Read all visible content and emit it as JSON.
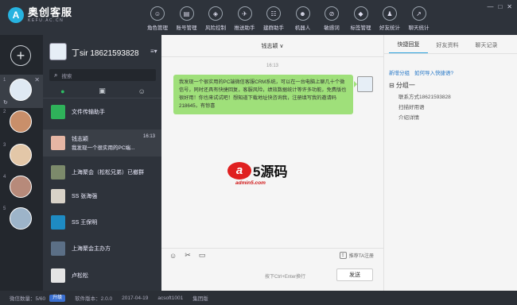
{
  "app": {
    "title": "奥创客服",
    "subtitle": "KEFU.AC.CN",
    "logo_letter": "A"
  },
  "nav": [
    {
      "label": "角色管理",
      "icon": "user-icon",
      "glyph": "☺"
    },
    {
      "label": "账号管理",
      "icon": "account-icon",
      "glyph": "▤"
    },
    {
      "label": "风险控制",
      "icon": "shield-icon",
      "glyph": "◈"
    },
    {
      "label": "推送助手",
      "icon": "push-icon",
      "glyph": "✈"
    },
    {
      "label": "建群助手",
      "icon": "group-icon",
      "glyph": "☷"
    },
    {
      "label": "机器人",
      "icon": "robot-icon",
      "glyph": "☻"
    },
    {
      "label": "敏感词",
      "icon": "block-icon",
      "glyph": "⊘"
    },
    {
      "label": "标签管理",
      "icon": "tag-icon",
      "glyph": "◆"
    },
    {
      "label": "好友统计",
      "icon": "stats-icon",
      "glyph": "♟"
    },
    {
      "label": "聊天统计",
      "icon": "chart-icon",
      "glyph": "↗"
    }
  ],
  "window_controls": [
    "—",
    "□",
    "✕"
  ],
  "rail": {
    "add": "+",
    "tabs": [
      "1",
      "2",
      "3",
      "4",
      "5"
    ],
    "close": "✕",
    "refresh": "↻"
  },
  "me": {
    "name": "丁sir 18621593828",
    "menu": "≡▾"
  },
  "search": {
    "placeholder": "搜索",
    "icon": "⌕"
  },
  "contact_tabs": [
    "●",
    "▣",
    "☺"
  ],
  "contacts": [
    {
      "name": "文件传输助手",
      "msg": "",
      "time": ""
    },
    {
      "name": "钱志颖",
      "msg": "我发现一个很实用的PC端...",
      "time": "16:13"
    },
    {
      "name": "上海聚会（松松兄弟）已撤群",
      "msg": "",
      "time": ""
    },
    {
      "name": "SS 张海强",
      "msg": "",
      "time": ""
    },
    {
      "name": "SS 王保明",
      "msg": "",
      "time": ""
    },
    {
      "name": "上海聚会主办方",
      "msg": "",
      "time": ""
    },
    {
      "name": "卢松松",
      "msg": "",
      "time": ""
    }
  ],
  "chat": {
    "title": "钱志颖 ∨",
    "time": "16:13",
    "message": "我发现一个很实用的PC端微信客服CRM系统，可以在一台电脑上聊几十个微信号，同时还具有快捷回复，客服风险，绩效数据统计等许多功能，免费版也很好用！你也来试试吧！想知道下载地址快咨询我，注册填写我的邀请码 218645，有惊喜",
    "watermark": {
      "mark": "a",
      "brand": "5源码",
      "url": "admin5.com"
    },
    "tools": [
      "☺",
      "✂",
      "▭"
    ],
    "recommend": "推荐TA注册",
    "recommend_icon": "⇪",
    "hint": "按下Ctrl+Enter换行",
    "send": "发送"
  },
  "right": {
    "tabs": [
      "快捷回复",
      "好友资料",
      "聊天记录"
    ],
    "links": [
      "新增分组",
      "如何导入快捷语?"
    ],
    "group": "⊟ 分组一",
    "items": [
      "联系方式18621593828",
      "扫描好用语",
      "介绍详情"
    ]
  },
  "status": {
    "friends": "微信数量：5/60",
    "badge": "升级",
    "version": "软件版本：2.0.0",
    "date": "2017-04-19",
    "account": "acsoft1001",
    "edition": "集团版"
  }
}
